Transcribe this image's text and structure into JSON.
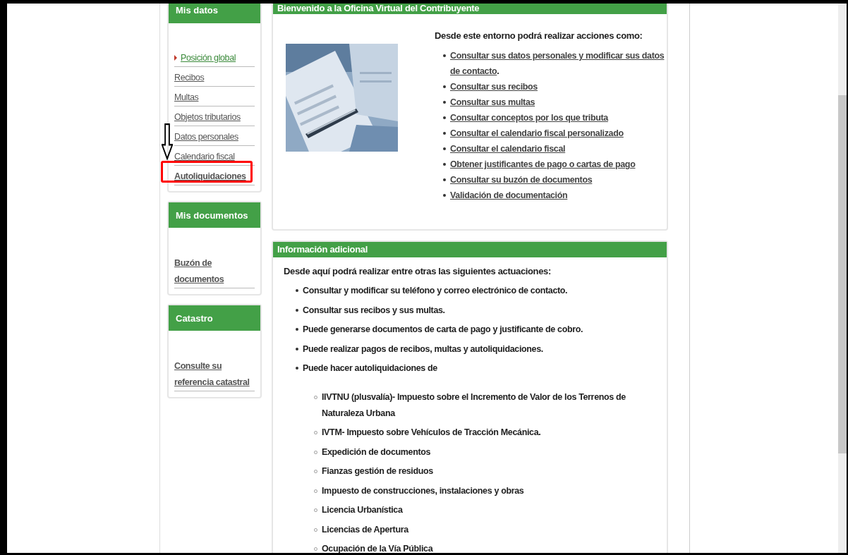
{
  "sidebar": [
    {
      "title": "Mis datos",
      "items": [
        {
          "label": "Posición global",
          "selected": true,
          "emphasized": false
        },
        {
          "label": "Recibos",
          "selected": false,
          "emphasized": false
        },
        {
          "label": "Multas",
          "selected": false,
          "emphasized": false
        },
        {
          "label": "Objetos tributarios",
          "selected": false,
          "emphasized": false
        },
        {
          "label": "Datos personales",
          "selected": false,
          "emphasized": false
        },
        {
          "label": "Calendario fiscal",
          "selected": false,
          "emphasized": false
        },
        {
          "label": "Autoliquidaciones",
          "selected": false,
          "emphasized": true
        }
      ]
    },
    {
      "title": "Mis documentos",
      "items": [
        {
          "label": "Buzón de documentos",
          "selected": false,
          "emphasized": true
        }
      ]
    },
    {
      "title": "Catastro",
      "items": [
        {
          "label": "Consulte su referencia catastral",
          "selected": false,
          "emphasized": true
        }
      ]
    }
  ],
  "welcome": {
    "title": "Bienvenido a la Oficina Virtual del Contribuyente",
    "intro": "Desde este entorno podrá realizar acciones como:",
    "links": [
      {
        "text": "Consultar sus datos personales y modificar sus datos de contacto",
        "suffix": "."
      },
      {
        "text": "Consultar sus recibos"
      },
      {
        "text": "Consultar sus multas"
      },
      {
        "text": "Consultar conceptos por los que tributa"
      },
      {
        "text": "Consultar el calendario fiscal personalizado"
      },
      {
        "text": "Consultar el calendario fiscal"
      },
      {
        "text": "Obtener justificantes de pago o cartas de pago"
      },
      {
        "text": "Consultar su buzón de documentos"
      },
      {
        "text": "Validación de documentación"
      }
    ]
  },
  "additional": {
    "title": "Información adicional",
    "intro": "Desde aquí podrá realizar entre otras las siguientes actuaciones:",
    "items": [
      {
        "text": "Consultar y modificar su teléfono y correo electrónico de contacto."
      },
      {
        "text": "Consultar sus recibos y sus multas."
      },
      {
        "text": "Puede generarse documentos de carta de pago y justificante de cobro."
      },
      {
        "text": "Puede realizar pagos de recibos, multas y autoliquidaciones."
      },
      {
        "text": "Puede hacer autoliquidaciones de",
        "children": [
          {
            "text": "IIVTNU (plusvalía)- Impuesto sobre el Incremento de Valor de los Terrenos de Naturaleza Urbana"
          },
          {
            "text": "IVTM- Impuesto sobre Vehículos de Tracción Mecánica."
          },
          {
            "text": "Expedición de documentos"
          },
          {
            "text": "Fianzas gestión de residuos"
          },
          {
            "text": "Impuesto de construcciones, instalaciones y obras"
          },
          {
            "text": "Licencia Urbanística"
          },
          {
            "text": "Licencias de Apertura"
          },
          {
            "text": "Ocupación de la Vía Pública"
          }
        ]
      }
    ]
  }
}
